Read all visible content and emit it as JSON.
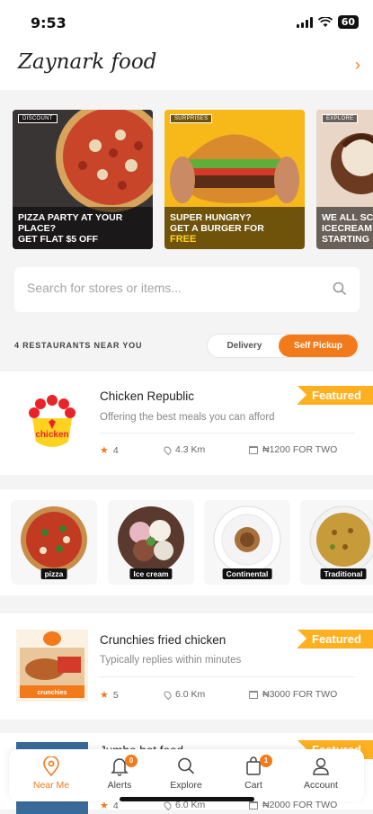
{
  "status": {
    "time": "9:53",
    "battery": "60"
  },
  "header": {
    "logo": "Zaynark food"
  },
  "banners": [
    {
      "tag": "DISCOUNT",
      "line1": "PIZZA PARTY AT YOUR",
      "line2": "PLACE?",
      "line3": "GET FLAT $5 OFF"
    },
    {
      "tag": "SURPRISES",
      "line1": "SUPER HUNGRY?",
      "line2": "GET A BURGER FOR",
      "line3": "FREE"
    },
    {
      "tag": "EXPLORE",
      "line1": "WE ALL SC",
      "line2": "ICECREAM",
      "line3": "STARTING"
    }
  ],
  "search": {
    "placeholder": "Search for stores or items..."
  },
  "filter": {
    "count_label": "4 RESTAURANTS NEAR YOU",
    "delivery": "Delivery",
    "pickup": "Self Pickup"
  },
  "restaurants": [
    {
      "name": "Chicken Republic",
      "subtitle": "Offering the best meals you can afford",
      "badge": "Featured",
      "rating": "4",
      "distance": "4.3 Km",
      "price": "₦1200 FOR TWO",
      "logo_text": "chicken"
    },
    {
      "name": "Crunchies fried chicken",
      "subtitle": "Typically replies within minutes",
      "badge": "Featured",
      "rating": "5",
      "distance": "6.0 Km",
      "price": "₦3000 FOR TWO",
      "logo_text": "crunchies"
    },
    {
      "name": "Jumbo hot food",
      "subtitle": "",
      "badge": "Featured",
      "rating": "4",
      "distance": "6.0 Km",
      "price": "₦2000 FOR TWO"
    }
  ],
  "categories": [
    {
      "label": "pizza"
    },
    {
      "label": "Ice cream"
    },
    {
      "label": "Continental"
    },
    {
      "label": "Traditional"
    }
  ],
  "nav": {
    "items": [
      {
        "label": "Near Me"
      },
      {
        "label": "Alerts",
        "badge": "0"
      },
      {
        "label": "Explore"
      },
      {
        "label": "Cart",
        "badge": "1"
      },
      {
        "label": "Account"
      }
    ]
  },
  "colors": {
    "accent": "#f27a1a",
    "featured": "#ffb020"
  }
}
